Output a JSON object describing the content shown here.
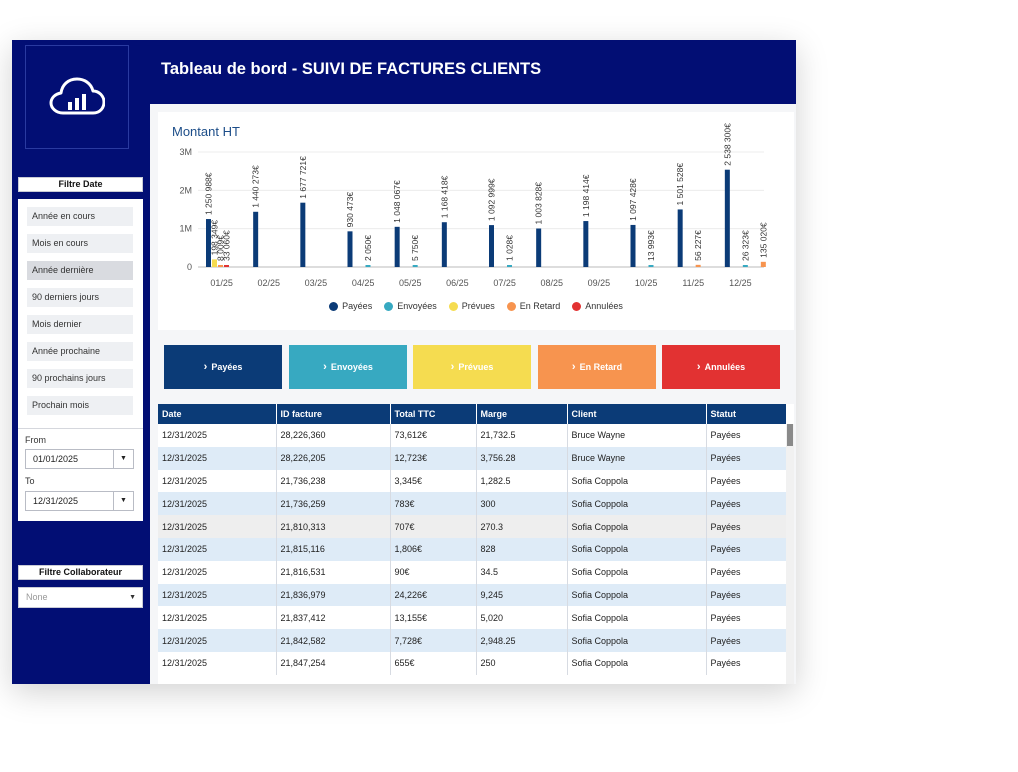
{
  "header": {
    "title": "Tableau de bord - SUIVI DE FACTURES CLIENTS"
  },
  "logo": {
    "icon": "cloud-chart-icon"
  },
  "date_filter": {
    "title": "Filtre Date",
    "items": [
      "Année en cours",
      "Mois en cours",
      "Année dernière",
      "90 derniers jours",
      "Mois dernier",
      "Année prochaine",
      "90 prochains jours",
      "Prochain mois"
    ],
    "active_index": 2,
    "from_label": "From",
    "from_value": "01/01/2025",
    "to_label": "To",
    "to_value": "12/31/2025"
  },
  "collab_filter": {
    "title": "Filtre Collaborateur",
    "value": "None"
  },
  "chart_data": {
    "type": "bar",
    "title": "Montant HT",
    "categories": [
      "01/25",
      "02/25",
      "03/25",
      "04/25",
      "05/25",
      "06/25",
      "07/25",
      "08/25",
      "09/25",
      "10/25",
      "11/25",
      "12/25"
    ],
    "y_ticks": [
      "0",
      "1M",
      "2M",
      "3M"
    ],
    "ylim": [
      0,
      3000000
    ],
    "series": [
      {
        "name": "Payées",
        "color": "#0b3b77",
        "values": [
          1250988,
          1440273,
          1677721,
          930473,
          1048067,
          1168418,
          1092999,
          1003828,
          1198414,
          1097428,
          1501528,
          2538300
        ],
        "labels": [
          "1 250 988€",
          "1 440 273€",
          "1 677 721€",
          "930 473€",
          "1 048 067€",
          "1 168 418€",
          "1 092 999€",
          "1 003 828€",
          "1 198 414€",
          "1 097 428€",
          "1 501 528€",
          "2 538 300€"
        ]
      },
      {
        "name": "Envoyées",
        "color": "#37a9c1",
        "values": [
          null,
          null,
          null,
          2050,
          5750,
          null,
          1028,
          null,
          null,
          13993,
          null,
          26323
        ],
        "labels": [
          "",
          "",
          "",
          "2 050€",
          "5 750€",
          "",
          "1 028€",
          "",
          "",
          "13 993€",
          "",
          "26 323€"
        ]
      },
      {
        "name": "Prévues",
        "color": "#f5dc50",
        "values": [
          198349,
          null,
          null,
          null,
          null,
          null,
          null,
          null,
          null,
          null,
          null,
          null
        ],
        "labels": [
          "198 349€",
          "",
          "",
          "",
          "",
          "",
          "",
          "",
          "",
          "",
          "",
          ""
        ]
      },
      {
        "name": "En Retard",
        "color": "#f7944f",
        "values": [
          8009,
          null,
          null,
          null,
          null,
          null,
          null,
          null,
          null,
          null,
          56227,
          135020
        ],
        "labels": [
          "8 009€",
          "",
          "",
          "",
          "",
          "",
          "",
          "",
          "",
          "",
          "56 227€",
          "135 020€"
        ]
      },
      {
        "name": "Annulées",
        "color": "#e23232",
        "values": [
          33060,
          null,
          null,
          null,
          null,
          null,
          null,
          null,
          null,
          null,
          null,
          null
        ],
        "labels": [
          "33 060€",
          "",
          "",
          "",
          "",
          "",
          "",
          "",
          "",
          "",
          "",
          ""
        ]
      }
    ]
  },
  "status_buttons": [
    {
      "label": "Payées",
      "color": "#0b3b77",
      "text_color": "#ffffff"
    },
    {
      "label": "Envoyées",
      "color": "#37a9c1",
      "text_color": "#ffffff"
    },
    {
      "label": "Prévues",
      "color": "#f5dc50",
      "text_color": "#ffffff"
    },
    {
      "label": "En Retard",
      "color": "#f7944f",
      "text_color": "#ffffff"
    },
    {
      "label": "Annulées",
      "color": "#e23232",
      "text_color": "#ffffff"
    }
  ],
  "table": {
    "headers": [
      "Date",
      "ID facture",
      "Total TTC",
      "Marge",
      "Client",
      "Statut"
    ],
    "rows": [
      [
        "12/31/2025",
        "28,226,360",
        "73,612€",
        "21,732.5",
        "Bruce Wayne",
        "Payées"
      ],
      [
        "12/31/2025",
        "28,226,205",
        "12,723€",
        "3,756.28",
        "Bruce Wayne",
        "Payées"
      ],
      [
        "12/31/2025",
        "21,736,238",
        "3,345€",
        "1,282.5",
        "Sofia Coppola",
        "Payées"
      ],
      [
        "12/31/2025",
        "21,736,259",
        "783€",
        "300",
        "Sofia Coppola",
        "Payées"
      ],
      [
        "12/31/2025",
        "21,810,313",
        "707€",
        "270.3",
        "Sofia Coppola",
        "Payées"
      ],
      [
        "12/31/2025",
        "21,815,116",
        "1,806€",
        "828",
        "Sofia Coppola",
        "Payées"
      ],
      [
        "12/31/2025",
        "21,816,531",
        "90€",
        "34.5",
        "Sofia Coppola",
        "Payées"
      ],
      [
        "12/31/2025",
        "21,836,979",
        "24,226€",
        "9,245",
        "Sofia Coppola",
        "Payées"
      ],
      [
        "12/31/2025",
        "21,837,412",
        "13,155€",
        "5,020",
        "Sofia Coppola",
        "Payées"
      ],
      [
        "12/31/2025",
        "21,842,582",
        "7,728€",
        "2,948.25",
        "Sofia Coppola",
        "Payées"
      ],
      [
        "12/31/2025",
        "21,847,254",
        "655€",
        "250",
        "Sofia Coppola",
        "Payées"
      ]
    ]
  }
}
